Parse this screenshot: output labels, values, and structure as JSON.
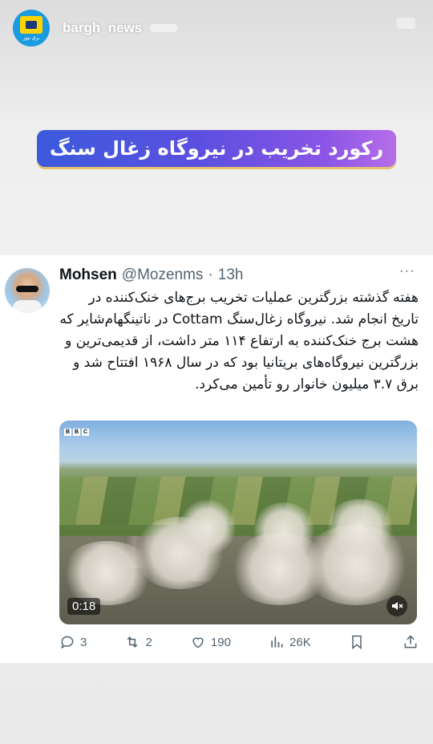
{
  "story": {
    "username": "bargh_news",
    "logo_text": "برق نیوز"
  },
  "banner": {
    "title": "رکورد تخریب در نیروگاه زغال سنگ"
  },
  "tweet": {
    "name": "Mohsen",
    "handle": "@Mozenms",
    "separator": "·",
    "time": "13h",
    "more": "···",
    "body": "هفته گذشته بزرگترین عملیات تخریب برج‌های خنک‌کننده در تاریخ انجام شد. نیروگاه زغال‌سنگ Cottam در ناتینگهام‌شایر که هشت برج خنک‌کننده به ارتفاع ۱۱۴ متر داشت، از قدیمی‌ترین و بزرگترین نیروگاه‌های بریتانیا بود که در سال ۱۹۶۸ افتتاح شد و برق ۳.۷ میلیون خانوار رو تأمین می‌کرد.",
    "media": {
      "watermark": [
        "B",
        "B",
        "C"
      ],
      "duration": "0:18"
    },
    "actions": {
      "replies": "3",
      "retweets": "2",
      "likes": "190",
      "views": "26K"
    }
  },
  "icons": [
    "reply-icon",
    "retweet-icon",
    "like-icon",
    "views-icon",
    "bookmark-icon",
    "share-icon",
    "mute-icon"
  ]
}
